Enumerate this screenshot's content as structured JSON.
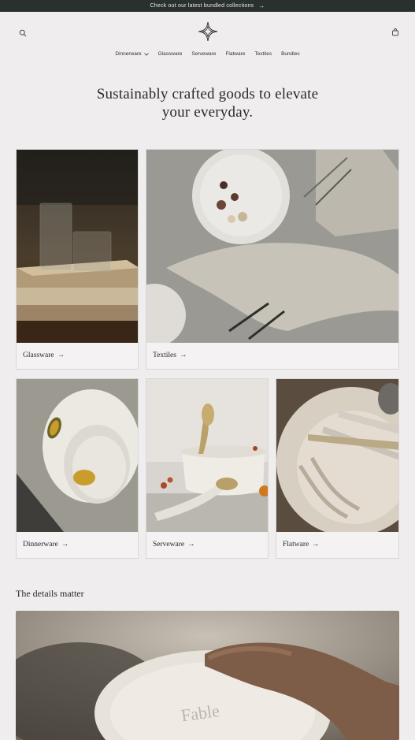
{
  "announcement": {
    "text": "Check out our latest bundled collections",
    "arrow": "→"
  },
  "nav": {
    "items": [
      {
        "label": "Dinnerware",
        "has_dropdown": true
      },
      {
        "label": "Glassware"
      },
      {
        "label": "Serveware"
      },
      {
        "label": "Flatware"
      },
      {
        "label": "Textiles"
      },
      {
        "label": "Bundles"
      }
    ]
  },
  "hero": {
    "line1": "Sustainably crafted goods to elevate",
    "line2": "your everyday."
  },
  "collections": [
    {
      "label": "Glassware",
      "arrow": "→"
    },
    {
      "label": "Textiles",
      "arrow": "→"
    },
    {
      "label": "Dinnerware",
      "arrow": "→"
    },
    {
      "label": "Serveware",
      "arrow": "→"
    },
    {
      "label": "Flatware",
      "arrow": "→"
    }
  ],
  "details": {
    "title": "The details matter",
    "stamp": "Fable"
  },
  "icons": {
    "search": "search-icon",
    "cart": "cart-icon",
    "logo": "star-logo-icon",
    "dropdown": "chevron-down-icon"
  },
  "colors": {
    "announcement_bg": "#2a302d",
    "page_bg": "#efedee",
    "text": "#2a2a2a"
  }
}
